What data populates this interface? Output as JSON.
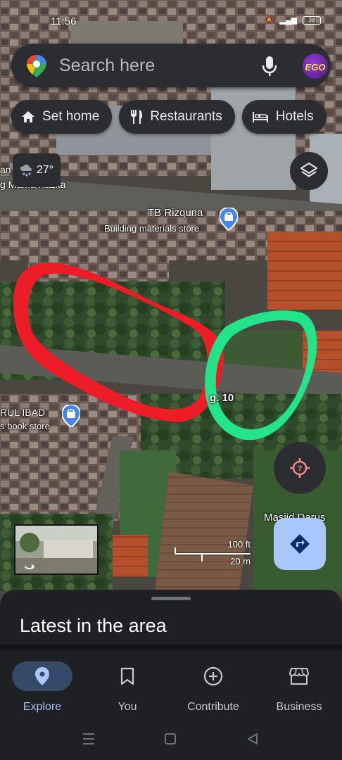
{
  "status_bar": {
    "time": "11:56",
    "battery": "38"
  },
  "search": {
    "placeholder": "Search here",
    "avatar_text": "EGO"
  },
  "chips": [
    {
      "label": "Set home",
      "icon": "home-icon"
    },
    {
      "label": "Restaurants",
      "icon": "fork-knife-icon"
    },
    {
      "label": "Hotels",
      "icon": "bed-icon"
    }
  ],
  "weather": {
    "temperature": "27°",
    "icon": "rain-cloud-icon"
  },
  "map": {
    "labels": {
      "top_left_fragment_1": "an",
      "top_left_fragment_2": "g Mama Kazka",
      "street": "g. 10",
      "left_poi_name": "RUL IBAD",
      "left_poi_category": "s book store",
      "mosque": "Masjid Darus"
    },
    "poi_store": {
      "name": "TB Rizquna",
      "category": "Building materials store"
    },
    "annotation_colors": {
      "red_outline": "#ee1c24",
      "green_outline": "#22e58a"
    },
    "scale": {
      "feet": "100 ft",
      "meters": "20 m"
    }
  },
  "sheet": {
    "heading": "Latest in the area"
  },
  "bottom_nav": [
    {
      "label": "Explore",
      "icon": "location-pin-icon",
      "active": true
    },
    {
      "label": "You",
      "icon": "bookmark-icon",
      "active": false
    },
    {
      "label": "Contribute",
      "icon": "add-circle-icon",
      "active": false
    },
    {
      "label": "Business",
      "icon": "storefront-icon",
      "active": false
    }
  ],
  "colors": {
    "accent": "#a8c7fa",
    "surface": "#2b2d31",
    "active_nav_bg": "#334a68"
  }
}
